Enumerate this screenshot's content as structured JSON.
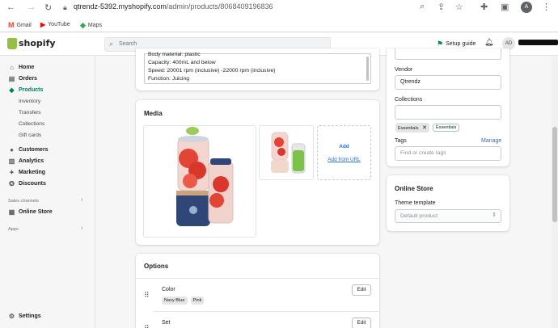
{
  "browser": {
    "url_host": "qtrendz-5392.myshopify.com",
    "url_path": "/admin/products/8068409196836",
    "profile_initial": "A",
    "bookmarks": [
      {
        "label": "Gmail",
        "icon": "gmail-icon",
        "color": "#ea4335",
        "glyph": "M"
      },
      {
        "label": "YouTube",
        "icon": "youtube-icon",
        "color": "#ff0000",
        "glyph": "▶"
      },
      {
        "label": "Maps",
        "icon": "maps-icon",
        "color": "#34a853",
        "glyph": "◆"
      }
    ]
  },
  "topbar": {
    "logo_text": "shopify",
    "search_placeholder": "Search",
    "setup_guide": "Setup guide",
    "avatar_initials": "AD",
    "brand_color": "#95bf47",
    "accent_color": "#008060"
  },
  "sidebar": {
    "items": [
      {
        "label": "Home",
        "icon": "home-icon",
        "glyph": "⌂"
      },
      {
        "label": "Orders",
        "icon": "orders-icon",
        "glyph": "▤"
      },
      {
        "label": "Products",
        "icon": "products-icon",
        "glyph": "◆",
        "active": true
      }
    ],
    "product_sub": [
      "Inventory",
      "Transfers",
      "Collections",
      "Gift cards"
    ],
    "items2": [
      {
        "label": "Customers",
        "icon": "customers-icon",
        "glyph": "●"
      },
      {
        "label": "Analytics",
        "icon": "analytics-icon",
        "glyph": "▥"
      },
      {
        "label": "Marketing",
        "icon": "marketing-icon",
        "glyph": "✦"
      },
      {
        "label": "Discounts",
        "icon": "discounts-icon",
        "glyph": "✪"
      }
    ],
    "sales_channels_label": "Sales channels",
    "online_store": "Online Store",
    "apps_label": "Apps",
    "settings": "Settings"
  },
  "description": {
    "lines": [
      "Body material: plastic",
      "Capacity: 400mL and below",
      "Speed: 20001 rpm (inclusive) -22000 rpm (inclusive)",
      "Function: Juicing"
    ]
  },
  "media": {
    "title": "Media",
    "add_label": "Add",
    "add_from_url": "Add from URL"
  },
  "options": {
    "title": "Options",
    "items": [
      {
        "name": "Color",
        "values": [
          "Navy Blue",
          "Pink"
        ],
        "edit": "Edit"
      },
      {
        "name": "Set",
        "values": [],
        "edit": "Edit"
      }
    ]
  },
  "organization": {
    "vendor_label": "Vendor",
    "vendor_value": "Qtrendz",
    "collections_label": "Collections",
    "collection_tags": [
      "Essentials"
    ],
    "collection_suggestion": "Essentials",
    "tags_label": "Tags",
    "manage_label": "Manage",
    "tags_placeholder": "Find or create tags"
  },
  "online_store_card": {
    "title": "Online Store",
    "theme_template_label": "Theme template",
    "theme_template_value": "Default product"
  }
}
